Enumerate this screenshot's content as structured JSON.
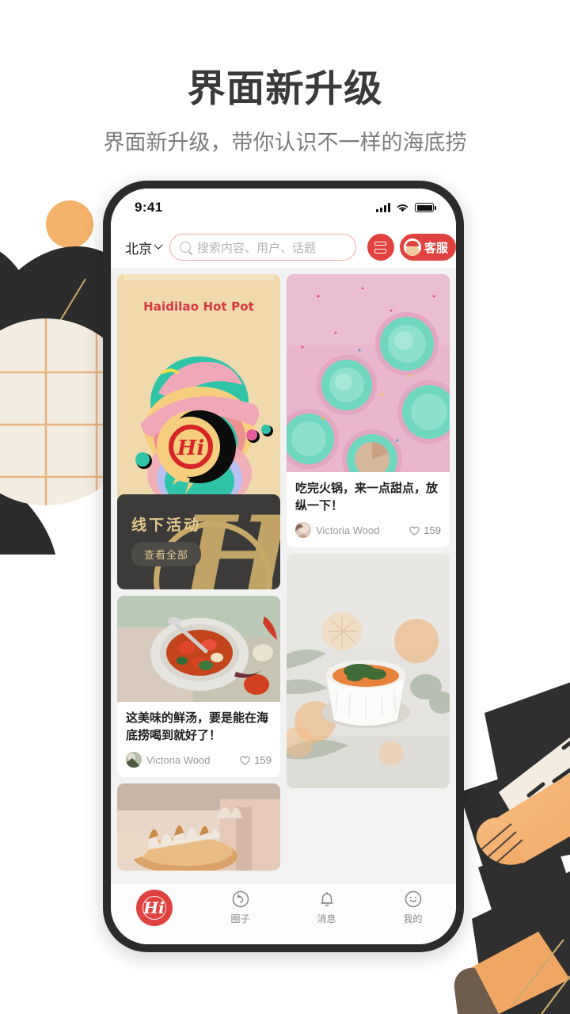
{
  "header": {
    "title": "界面新升级",
    "subtitle": "界面新升级，带你认识不一样的海底捞"
  },
  "phone": {
    "status_bar": {
      "time": "9:41"
    },
    "top_bar": {
      "city": "北京",
      "search_placeholder": "搜索内容、用户、话题",
      "grid_button_label": "",
      "service_button_label": "客服"
    },
    "hero_card": {
      "brand_title": "Haidilao Hot Pot",
      "logo_text": "Hi",
      "section_label": "线下活动",
      "view_all_label": "查看全部"
    },
    "posts": [
      {
        "title": "吃完火锅，来一点甜点，放纵一下！",
        "author": "Victoria Wood",
        "likes": "159",
        "image": "teal-frosted-cupcakes-on-pink"
      },
      {
        "title": "这美味的鲜汤，要是能在海底捞喝到就好了！",
        "author": "Victoria Wood",
        "likes": "159",
        "image": "tomato-vegetable-soup-in-stone-bowl"
      },
      {
        "title": "",
        "author": "",
        "likes": "",
        "image": "soup-ramekin-with-pine-and-bokeh"
      },
      {
        "title": "",
        "author": "",
        "likes": "",
        "image": "toasted-meringue-tarts"
      }
    ],
    "tabs": [
      {
        "label": "",
        "icon": "hi-logo-icon"
      },
      {
        "label": "圈子",
        "icon": "circle-refresh-icon"
      },
      {
        "label": "消息",
        "icon": "bell-icon"
      },
      {
        "label": "我的",
        "icon": "smiley-face-icon"
      }
    ]
  },
  "colors": {
    "brand_red": "#e0433f",
    "hero_sand": "#efd9ad",
    "hero_dark": "#3c3b39",
    "gold": "#c9a96a",
    "text_dark": "#3a3a3a",
    "text_muted": "#7c7c7c",
    "decor_orange": "#f5b26b",
    "decor_dark": "#2c2c2c",
    "decor_cream": "#f3ece1"
  }
}
